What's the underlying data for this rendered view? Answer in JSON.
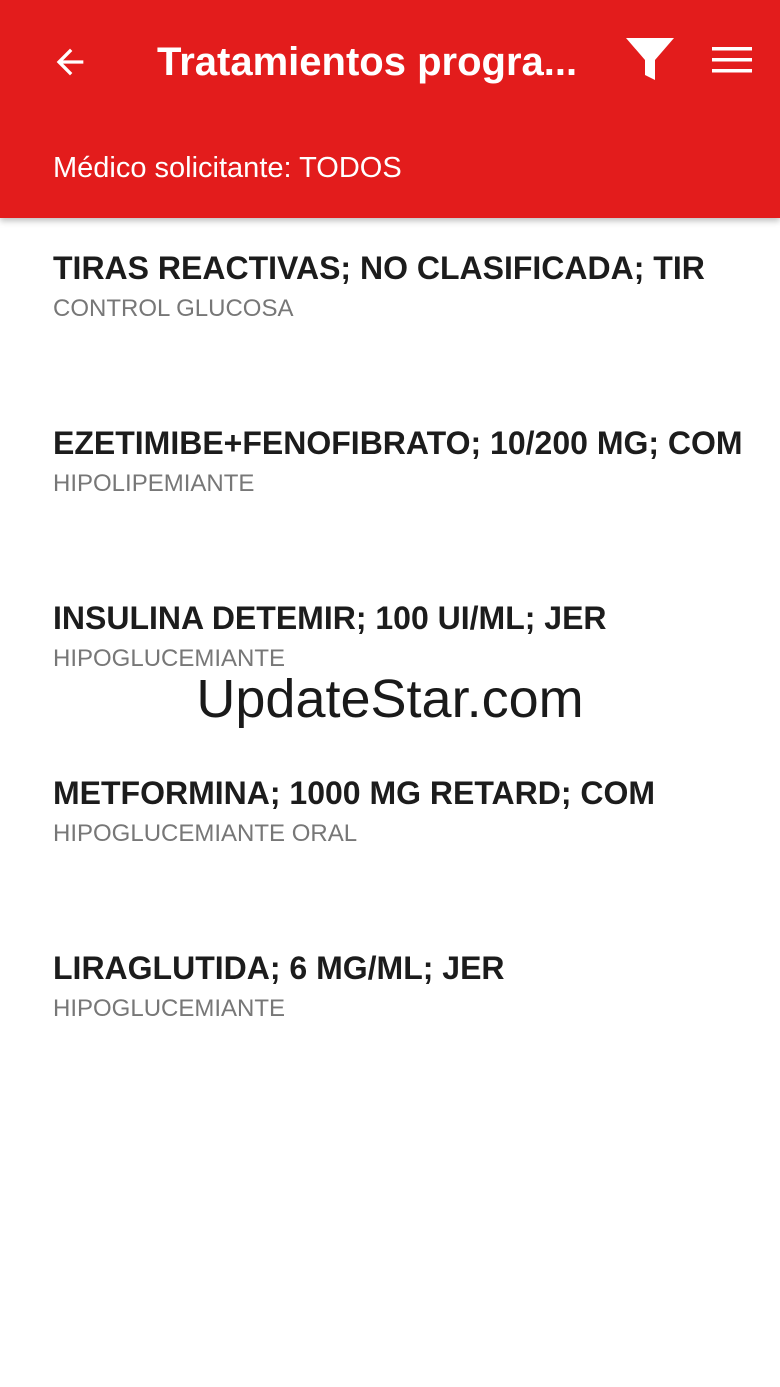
{
  "app_bar": {
    "title": "Tratamientos progra...",
    "subtitle": "Médico solicitante: TODOS",
    "color": "#e31c1c"
  },
  "icons": {
    "back": "arrow-back-icon",
    "filter": "filter-funnel-icon",
    "menu": "hamburger-menu-icon"
  },
  "treatments": [
    {
      "name": "TIRAS REACTIVAS; NO CLASIFICADA; TIR",
      "category": "CONTROL GLUCOSA"
    },
    {
      "name": "EZETIMIBE+FENOFIBRATO; 10/200 MG; COM",
      "category": "HIPOLIPEMIANTE"
    },
    {
      "name": "INSULINA DETEMIR; 100 UI/ML; JER",
      "category": "HIPOGLUCEMIANTE"
    },
    {
      "name": "METFORMINA; 1000 MG RETARD; COM",
      "category": "HIPOGLUCEMIANTE ORAL"
    },
    {
      "name": "LIRAGLUTIDA; 6 MG/ML; JER",
      "category": "HIPOGLUCEMIANTE"
    }
  ],
  "watermark": "UpdateStar.com"
}
